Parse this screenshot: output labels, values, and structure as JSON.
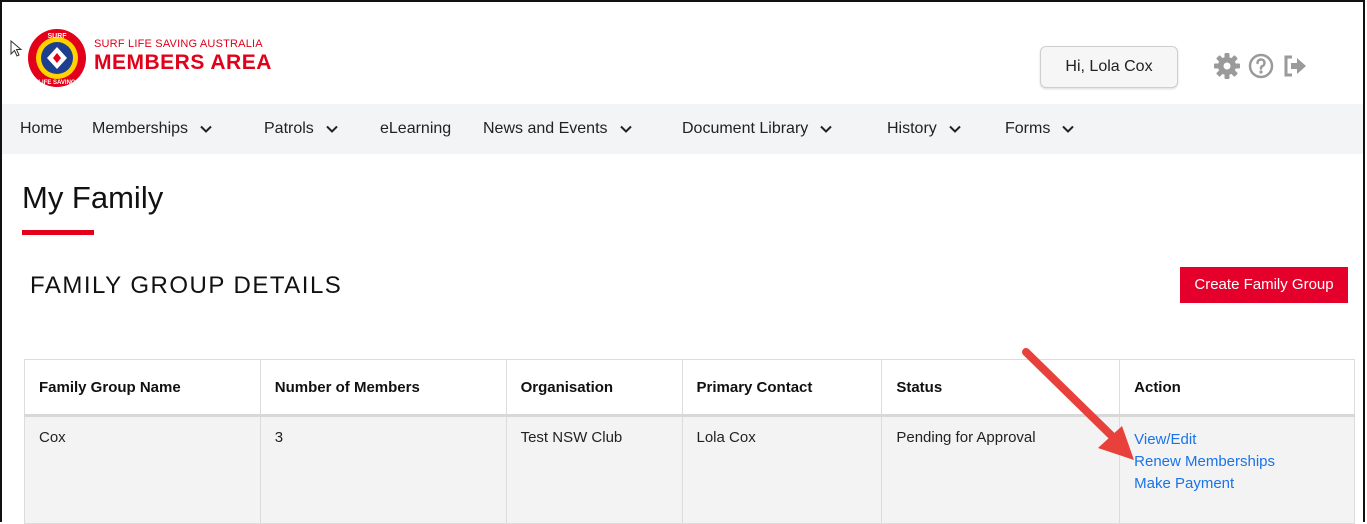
{
  "header": {
    "brand_top": "SURF LIFE SAVING AUSTRALIA",
    "brand_main": "MEMBERS AREA",
    "greeting": "Hi, Lola Cox",
    "icons": [
      "gear-icon",
      "help-circle-icon",
      "logout-icon"
    ]
  },
  "nav": {
    "items": [
      {
        "label": "Home",
        "dropdown": false
      },
      {
        "label": "Memberships",
        "dropdown": true
      },
      {
        "label": "Patrols",
        "dropdown": true
      },
      {
        "label": "eLearning",
        "dropdown": false
      },
      {
        "label": "News and Events",
        "dropdown": true
      },
      {
        "label": "Document Library",
        "dropdown": true
      },
      {
        "label": "History",
        "dropdown": true
      },
      {
        "label": "Forms",
        "dropdown": true
      }
    ]
  },
  "page": {
    "title": "My Family",
    "section_title": "FAMILY GROUP DETAILS",
    "create_button": "Create Family Group"
  },
  "table": {
    "columns": [
      "Family Group Name",
      "Number of Members",
      "Organisation",
      "Primary Contact",
      "Status",
      "Action"
    ],
    "rows": [
      {
        "name": "Cox",
        "members": "3",
        "organisation": "Test NSW Club",
        "primary_contact": "Lola Cox",
        "status": "Pending for Approval",
        "actions": [
          "View/Edit",
          "Renew Memberships",
          "Make Payment"
        ]
      }
    ]
  },
  "colors": {
    "brand_red": "#e2001a",
    "button_red": "#e4002b",
    "link_blue": "#1a73e8",
    "nav_bg": "#f3f4f5"
  }
}
